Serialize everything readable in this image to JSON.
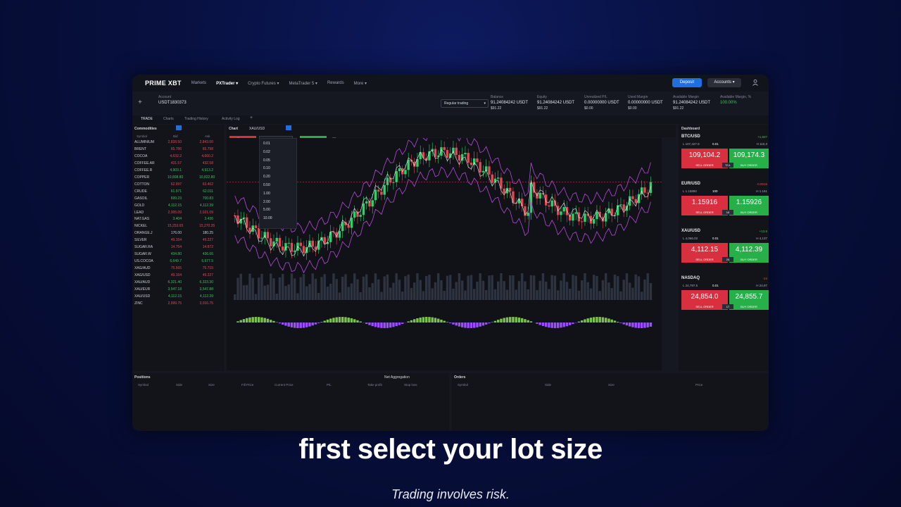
{
  "nav": {
    "logo": "PRIME XBT",
    "items": [
      "Markets",
      "PXTrader ▾",
      "Crypto Futures ▾",
      "MetaTrader 5 ▾",
      "Rewards",
      "More ▾"
    ],
    "deposit": "Deposit",
    "accounts": "Accounts ▾"
  },
  "account": {
    "label": "Account",
    "id": "USDT1830373",
    "mode": "Regular trading",
    "stats": [
      {
        "label": "Balance",
        "value": "91.24084242 USDT",
        "sub": "$91.22"
      },
      {
        "label": "Equity",
        "value": "91.24084242 USDT",
        "sub": "$91.22"
      },
      {
        "label": "Unrealized P/L",
        "value": "0.00000000 USDT",
        "sub": "$0.00"
      },
      {
        "label": "Used Margin",
        "value": "0.00000000 USDT",
        "sub": "$0.00"
      },
      {
        "label": "Available Margin",
        "value": "91.24084242 USDT",
        "sub": "$91.22"
      },
      {
        "label": "Available Margin, %",
        "value": "100.00%",
        "sub": ""
      }
    ]
  },
  "tabs": [
    "TRADE",
    "Charts",
    "Trading History",
    "Activity Log",
    "+"
  ],
  "watchlist": {
    "title": "Commodities",
    "columns": [
      "Symbol",
      "Bid",
      "Ask"
    ],
    "rows": [
      {
        "sym": "ALUMINIUM",
        "bid": "2,828.50",
        "ask": "2,843.00",
        "c": "red"
      },
      {
        "sym": "BRENT",
        "bid": "65.786",
        "ask": "65.798",
        "c": "red"
      },
      {
        "sym": "COCOA",
        "bid": "4,632.2",
        "ask": "4,660.2",
        "c": "red"
      },
      {
        "sym": "COFFEE.AR",
        "bid": "431.57",
        "ask": "432.58",
        "c": "red"
      },
      {
        "sym": "COFFEE.R",
        "bid": "4,903.1",
        "ask": "4,913.2",
        "c": "green"
      },
      {
        "sym": "COPPER",
        "bid": "10,808.80",
        "ask": "10,822.80",
        "c": "green"
      },
      {
        "sym": "COTTON",
        "bid": "62.997",
        "ask": "63.402",
        "c": "red"
      },
      {
        "sym": "CRUDE",
        "bid": "61.971",
        "ask": "62.011",
        "c": "green"
      },
      {
        "sym": "GASOIL",
        "bid": "699.23",
        "ask": "700.83",
        "c": "green"
      },
      {
        "sym": "GOLD",
        "bid": "4,112.15",
        "ask": "4,112.39",
        "c": "green"
      },
      {
        "sym": "LEAD",
        "bid": "2,005.09",
        "ask": "2,021.09",
        "c": "red"
      },
      {
        "sym": "NAT.GAS",
        "bid": "3.404",
        "ask": "3.436",
        "c": "green"
      },
      {
        "sym": "NICKEL",
        "bid": "15,253.65",
        "ask": "15,270.35",
        "c": "red"
      },
      {
        "sym": "ORANGE.J",
        "bid": "176.00",
        "ask": "180.25",
        "c": "white"
      },
      {
        "sym": "SILVER",
        "bid": "49.164",
        "ask": "49.227",
        "c": "red"
      },
      {
        "sym": "SUGAR.RA",
        "bid": "14.754",
        "ask": "14.872",
        "c": "red"
      },
      {
        "sym": "SUGAR.W",
        "bid": "434.80",
        "ask": "436.66",
        "c": "green"
      },
      {
        "sym": "US.COCOA",
        "bid": "6,649.7",
        "ask": "6,677.5",
        "c": "green"
      },
      {
        "sym": "XAG/AUD",
        "bid": "75.565",
        "ask": "75.715",
        "c": "red"
      },
      {
        "sym": "XAG/USD",
        "bid": "49.164",
        "ask": "49.227",
        "c": "red"
      },
      {
        "sym": "XAU/AUD",
        "bid": "6,321.40",
        "ask": "6,323.30",
        "c": "green"
      },
      {
        "sym": "XAU/EUR",
        "bid": "3,547.18",
        "ask": "3,547.88",
        "c": "green"
      },
      {
        "sym": "XAU/USD",
        "bid": "4,112.15",
        "ask": "4,112.39",
        "c": "green"
      },
      {
        "sym": "ZINC",
        "bid": "2,999.75",
        "ask": "3,016.75",
        "c": "red"
      }
    ]
  },
  "chart": {
    "title": "Chart",
    "symbol": "XAU/USD",
    "sell_price": "Sell 4,112.15",
    "lot": "0.01",
    "buy_price": "4,112.39 Buy",
    "interval": "15m",
    "lot_options": [
      "0.01",
      "0.02",
      "0.05",
      "0.10",
      "0.20",
      "0.50",
      "1.00",
      "2.00",
      "5.00",
      "10.00"
    ]
  },
  "dashboard": {
    "title": "Dashboard",
    "cards": [
      {
        "sym": "BTC/USD",
        "change": "+1,607",
        "low": "L 107,427.9",
        "qty": "0.01",
        "high": "H 110,3",
        "sell": "109,104.2",
        "buy": "109,174.3",
        "spread": "70.1"
      },
      {
        "sym": "EUR/USD",
        "change": "-0.0015",
        "low": "L 1.15850",
        "qty": "100",
        "high": "H 1.161",
        "sell": "1.15916",
        "buy": "1.15926",
        "spread": "10"
      },
      {
        "sym": "XAU/USD",
        "change": "+13.8",
        "low": "L 4,066.02",
        "qty": "0.01",
        "high": "H 4,137",
        "sell": "4,112.15",
        "buy": "4,112.39",
        "spread": "24"
      },
      {
        "sym": "NASDAQ",
        "change": "-24",
        "low": "L 24,797.5",
        "qty": "0.01",
        "high": "H 24,97",
        "sell": "24,854.0",
        "buy": "24,855.7",
        "spread": "17"
      }
    ],
    "sell_label": "SELL ORDER",
    "buy_label": "BUY ORDER"
  },
  "positions": {
    "title": "Positions",
    "aggregation": "Net Aggregation",
    "columns": [
      "Symbol",
      "Side",
      "Size",
      "Fill Price",
      "Current Price",
      "P/L",
      "Take profit",
      "Stop loss"
    ]
  },
  "orders": {
    "title": "Orders",
    "columns": [
      "Symbol",
      "Side",
      "Size",
      "Price"
    ]
  },
  "caption": "first select your lot size",
  "disclaimer": "Trading involves risk.",
  "colors": {
    "sell": "#d8303f",
    "buy": "#27b04a",
    "accent": "#1f6fe0"
  }
}
